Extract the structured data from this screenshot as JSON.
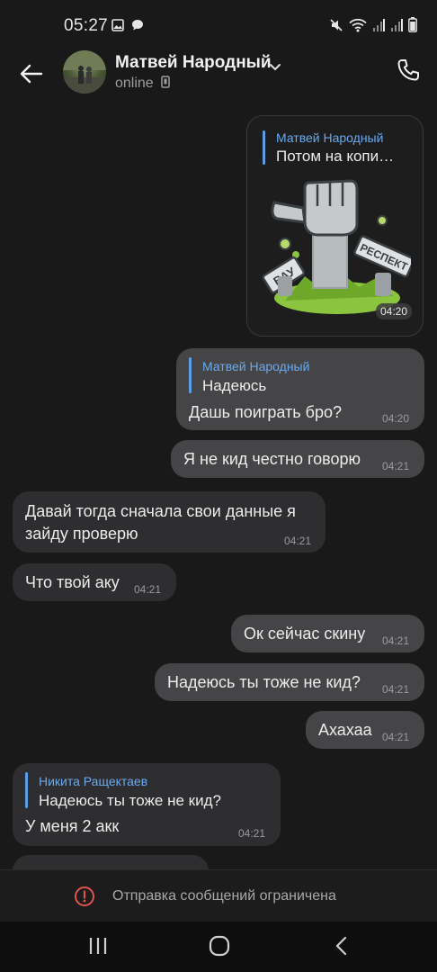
{
  "status_bar": {
    "time": "05:27",
    "left_icons": [
      "image-icon",
      "chat-icon"
    ],
    "right_icons": [
      "mute-icon",
      "wifi-icon",
      "signal-icon",
      "signal-icon",
      "battery-icon"
    ]
  },
  "header": {
    "name": "Матвей Народный",
    "status": "online",
    "back_icon": "arrow-left-icon",
    "call_icon": "phone-icon"
  },
  "messages": [
    {
      "direction": "out",
      "type": "sticker",
      "reply_name": "Матвей Народный",
      "reply_text": "Потом на копи…",
      "sticker_labels": [
        "ВАУ",
        "РЕСПЕКТ"
      ],
      "time": "04:20"
    },
    {
      "direction": "out",
      "reply_name": "Матвей Народный",
      "reply_text": "Надеюсь",
      "text": "Дашь поиграть бро?",
      "time": "04:20"
    },
    {
      "direction": "out",
      "text": "Я не кид честно говорю",
      "time": "04:21"
    },
    {
      "direction": "in",
      "text_lines": [
        "Давай тогда сначала свои данные я",
        "зайду проверю"
      ],
      "time": "04:21"
    },
    {
      "direction": "in",
      "text": "Что твой аку",
      "time": "04:21"
    },
    {
      "direction": "out",
      "text": "Ок сейчас скину",
      "time": "04:21"
    },
    {
      "direction": "out",
      "text": "Надеюсь ты тоже не кид?",
      "time": "04:21"
    },
    {
      "direction": "out",
      "text": "Ахахаа",
      "time": "04:21"
    },
    {
      "direction": "in",
      "reply_name": "Никита Ращектаев",
      "reply_text": "Надеюсь ты тоже не кид?",
      "text": "У меня 2 акк",
      "time": "04:21"
    }
  ],
  "banner": {
    "text": "Отправка сообщений ограничена",
    "icon": "alert-circle-icon",
    "accent": "#e0534f"
  },
  "nav": {
    "buttons": [
      "recent-apps-icon",
      "home-icon",
      "back-icon"
    ]
  },
  "colors": {
    "background": "#19191a",
    "outgoing_bubble": "#454547",
    "incoming_bubble": "#2e2e30",
    "reply_accent": "#6aa9ee"
  }
}
